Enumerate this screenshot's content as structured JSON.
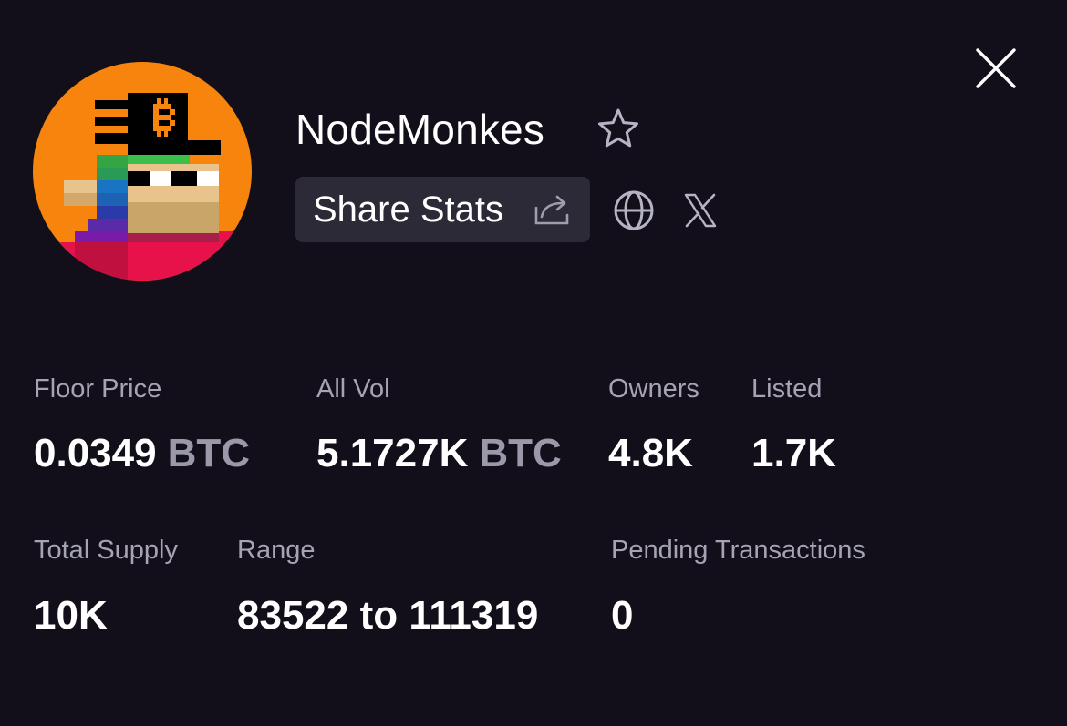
{
  "collection": {
    "name": "NodeMonkes",
    "share_label": "Share Stats"
  },
  "icons": {
    "close": "close-icon",
    "favorite": "star-outline-icon",
    "share": "share-arrow-icon",
    "website": "globe-icon",
    "twitter": "x-logo-icon"
  },
  "stats": {
    "floor_price": {
      "label": "Floor Price",
      "value": "0.0349",
      "unit": "BTC"
    },
    "all_vol": {
      "label": "All Vol",
      "value": "5.1727K",
      "unit": "BTC"
    },
    "owners": {
      "label": "Owners",
      "value": "4.8K"
    },
    "listed": {
      "label": "Listed",
      "value": "1.7K"
    },
    "total_supply": {
      "label": "Total Supply",
      "value": "10K"
    },
    "range": {
      "label": "Range",
      "value": "83522 to 111319"
    },
    "pending_transactions": {
      "label": "Pending Transactions",
      "value": "0"
    }
  },
  "colors": {
    "background": "#120f1a",
    "avatar_background": "#f7850d",
    "button_background": "#2c2a37",
    "label_text": "#a6a3b4",
    "unit_text": "#9b98aa"
  }
}
